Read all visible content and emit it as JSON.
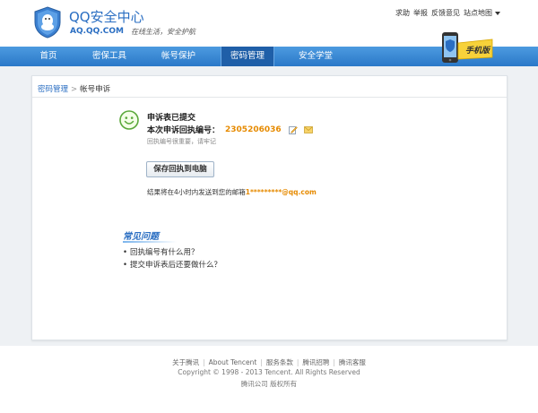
{
  "header": {
    "site_title": "QQ安全中心",
    "domain": "AQ.QQ.COM",
    "slogan": "在线生活，安全护航",
    "links": {
      "help": "求助",
      "report": "举报",
      "feedback": "反馈意见",
      "sitemap": "站点地图"
    }
  },
  "nav": {
    "items": [
      {
        "label": "首页"
      },
      {
        "label": "密保工具"
      },
      {
        "label": "帐号保护"
      },
      {
        "label": "密码管理"
      },
      {
        "label": "安全学堂"
      }
    ],
    "active_index": 3,
    "badge_text": "手机版"
  },
  "breadcrumb": {
    "parent": "密码管理",
    "separator": ">",
    "current": "帐号申诉"
  },
  "result": {
    "title": "申诉表已提交",
    "code_label": "本次申诉回执编号：",
    "code_value": "2305206036",
    "hint": "回执编号很重要，请牢记",
    "save_button": "保存回执到电脑",
    "notice_prefix": "结果将在4小时内发送到您的邮箱",
    "notice_email": "1*********@qq.com"
  },
  "faq": {
    "title": "常见问题",
    "items": [
      {
        "text": "回执编号有什么用？"
      },
      {
        "text": "提交申诉表后还要做什么？"
      }
    ]
  },
  "footer": {
    "links": [
      {
        "label": "关于腾讯"
      },
      {
        "label": "About Tencent"
      },
      {
        "label": "服务条款"
      },
      {
        "label": "腾讯招聘"
      },
      {
        "label": "腾讯客服"
      }
    ],
    "copyright": "Copyright © 1998 - 2013 Tencent. All Rights Reserved",
    "rights": "腾讯公司 版权所有"
  },
  "colors": {
    "brand_blue": "#2a6ec2",
    "nav_blue": "#2a78c8",
    "nav_active": "#1f5fa8",
    "highlight_orange": "#e68a00",
    "smiley_green": "#5aa83a"
  }
}
